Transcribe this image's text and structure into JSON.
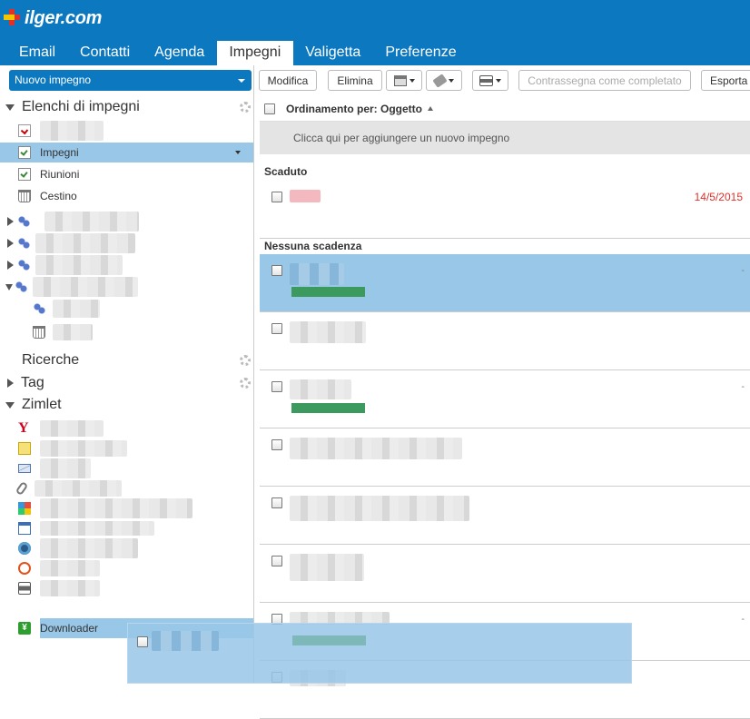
{
  "app": {
    "logo_text": "ilger.com"
  },
  "nav_tabs": [
    "Email",
    "Contatti",
    "Agenda",
    "Impegni",
    "Valigetta",
    "Preferenze"
  ],
  "active_tab": "Impegni",
  "left": {
    "new_button": "Nuovo impegno",
    "task_lists_title": "Elenchi di impegni",
    "task_lists": [
      "Impegni",
      "Riunioni",
      "Cestino"
    ],
    "searches_title": "Ricerche",
    "tags_title": "Tag",
    "zimlet_title": "Zimlet",
    "zimlet_downloader": "Downloader"
  },
  "toolbar": {
    "modify": "Modifica",
    "delete": "Elimina",
    "mark_complete": "Contrassegna come completato",
    "export": "Esporta"
  },
  "list": {
    "sort_label": "Ordinamento per: Oggetto",
    "add_hint": "Clicca qui per aggiungere un nuovo impegno",
    "group_overdue": "Scaduto",
    "overdue_date": "14/5/2015",
    "group_no_due": "Nessuna scadenza",
    "dash": "-"
  },
  "colors": {
    "accent": "#0b78c0",
    "selection": "#98c7e8",
    "progress": "#3d9a5e",
    "overdue": "#e0302a"
  }
}
